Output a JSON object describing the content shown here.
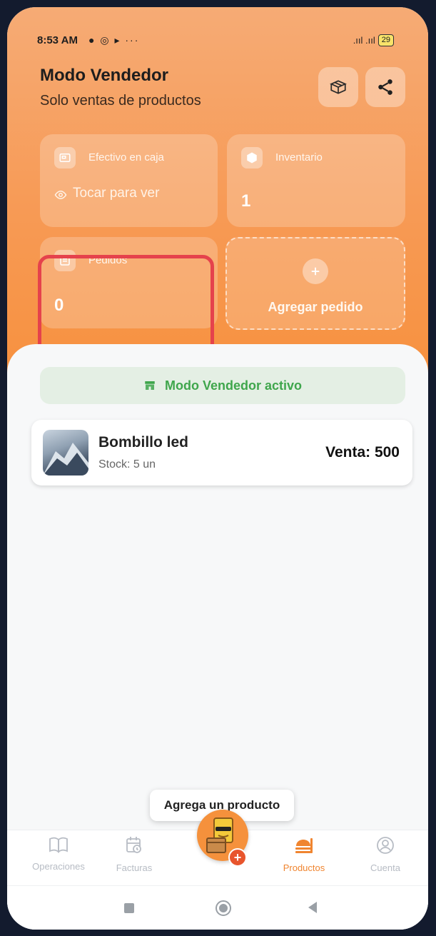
{
  "status_bar": {
    "time": "8:53 AM",
    "left_icons": "● ◎ ▸ ···",
    "signal": ".ııl .ııl",
    "battery": "29"
  },
  "header": {
    "title": "Modo Vendedor",
    "subtitle": "Solo ventas de productos"
  },
  "cards": {
    "cash": {
      "label": "Efectivo en caja",
      "value": "Tocar para ver"
    },
    "inventory": {
      "label": "Inventario",
      "value": "1"
    },
    "orders": {
      "label": "Pedidos",
      "value": "0"
    },
    "add_order": {
      "label": "Agregar pedido"
    }
  },
  "banner": {
    "text": "Modo Vendedor activo"
  },
  "products": [
    {
      "name": "Bombillo led",
      "stock": "Stock: 5 un",
      "price": "Venta: 500"
    }
  ],
  "tooltip": {
    "text": "Agrega un producto"
  },
  "tabs": [
    {
      "label": "Operaciones",
      "icon": "book-icon"
    },
    {
      "label": "Facturas",
      "icon": "calendar-icon"
    },
    {
      "label": "Productos",
      "icon": "products-icon"
    },
    {
      "label": "Cuenta",
      "icon": "user-icon"
    }
  ],
  "colors": {
    "accent": "#f79a55",
    "active_tab": "#f08530",
    "success": "#3fa64c",
    "highlight": "#e5424c"
  }
}
